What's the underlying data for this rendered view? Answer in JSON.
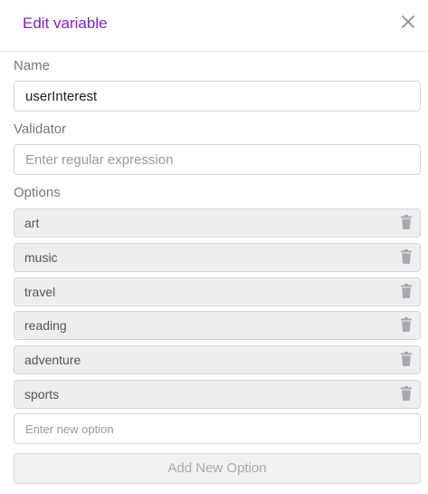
{
  "dialog": {
    "title": "Edit variable",
    "close_icon": "close-icon"
  },
  "name_field": {
    "label": "Name",
    "value": "userInterest"
  },
  "validator_field": {
    "label": "Validator",
    "value": "",
    "placeholder": "Enter regular expression"
  },
  "options": {
    "label": "Options",
    "items": [
      {
        "label": "art",
        "icon": "trash-icon"
      },
      {
        "label": "music",
        "icon": "trash-icon"
      },
      {
        "label": "travel",
        "icon": "trash-icon"
      },
      {
        "label": "reading",
        "icon": "trash-icon"
      },
      {
        "label": "adventure",
        "icon": "trash-icon"
      },
      {
        "label": "sports",
        "icon": "trash-icon"
      }
    ],
    "new_option_placeholder": "Enter new option",
    "add_button_label": "Add New Option"
  },
  "colors": {
    "accent": "#7b1fd6",
    "option_bg": "#eeeef1",
    "disabled_text": "#a8a8a8"
  }
}
